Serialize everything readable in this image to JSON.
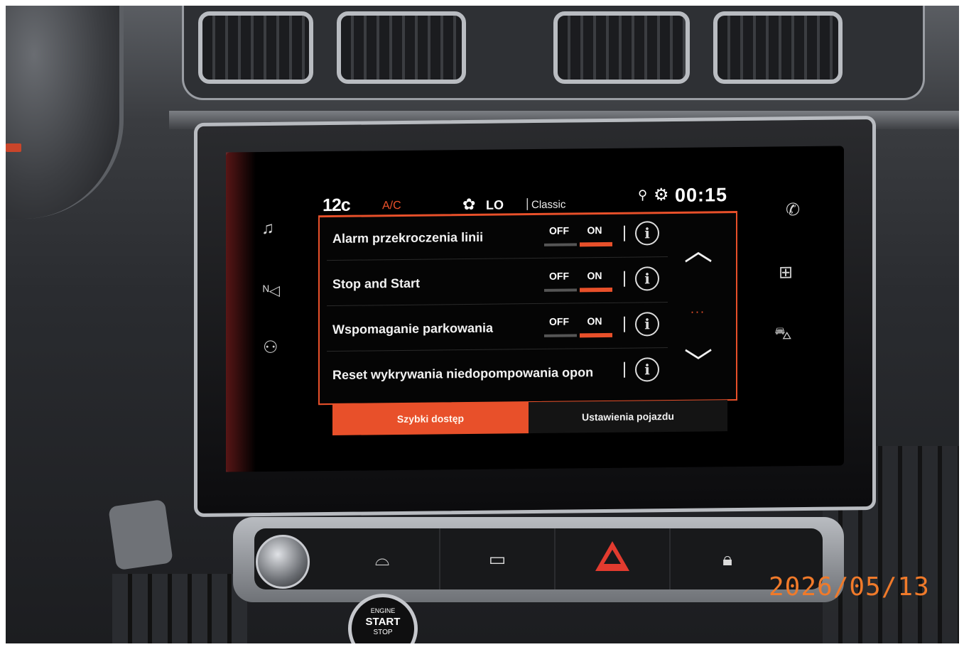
{
  "climate": {
    "temperature": "12c",
    "ac_label": "A/C",
    "fan_icon": "fan-icon",
    "fan_level": "LO",
    "separator": "|",
    "mode": "Classic"
  },
  "status": {
    "location_icon": "location-pin-icon",
    "settings_icon": "gear-icon",
    "time": "00:15"
  },
  "left_nav": {
    "items": [
      {
        "icon": "music-note-icon",
        "glyph": "♫"
      },
      {
        "icon": "navigation-icon",
        "glyph": "ᴺ◁"
      },
      {
        "icon": "connectivity-icon",
        "glyph": "⚇"
      }
    ]
  },
  "right_nav": {
    "items": [
      {
        "icon": "phone-icon",
        "glyph": "✆"
      },
      {
        "icon": "apps-grid-icon",
        "glyph": "⊞"
      },
      {
        "icon": "car-icon",
        "glyph": "⛍"
      }
    ]
  },
  "settings": {
    "rows": [
      {
        "label": "Alarm przekroczenia linii",
        "off": "OFF",
        "on": "ON",
        "value": "ON",
        "has_toggle": true
      },
      {
        "label": "Stop and Start",
        "off": "OFF",
        "on": "ON",
        "value": "ON",
        "has_toggle": true
      },
      {
        "label": "Wspomaganie parkowania",
        "off": "OFF",
        "on": "ON",
        "value": "ON",
        "has_toggle": true
      },
      {
        "label": "Reset wykrywania niedopompowania opon",
        "has_toggle": false
      }
    ],
    "info_glyph": "i",
    "scroll_up": "︿",
    "scroll_down": "﹀",
    "scroll_indicator": "..."
  },
  "tabs": [
    {
      "label": "Szybki dostęp",
      "active": true
    },
    {
      "label": "Ustawienia pojazdu",
      "active": false
    }
  ],
  "console": {
    "buttons": [
      {
        "icon": "front-defrost-icon",
        "glyph": "⌓"
      },
      {
        "icon": "rear-defrost-icon",
        "glyph": "▭"
      },
      {
        "icon": "hazard-icon",
        "glyph": ""
      },
      {
        "icon": "door-lock-icon",
        "glyph": "🔒︎"
      }
    ],
    "start_button": {
      "line1": "ENGINE",
      "line2": "START",
      "line3": "STOP"
    }
  },
  "photo_date": "2026/05/13",
  "colors": {
    "accent": "#e8502a",
    "screen_bg": "#000000",
    "text": "#f2f2f2"
  }
}
